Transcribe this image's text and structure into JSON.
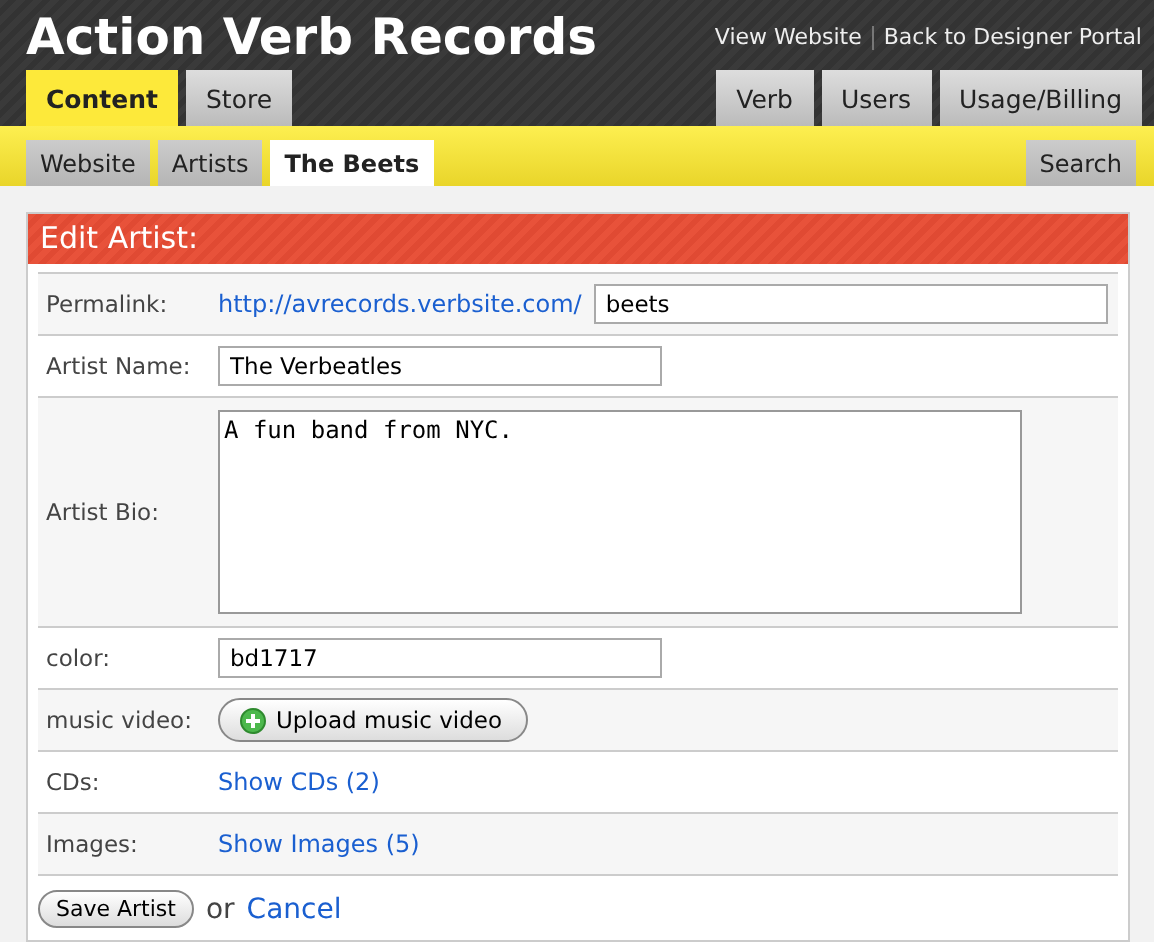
{
  "header": {
    "title": "Action Verb Records",
    "links": [
      "View Website",
      "Back to Designer Portal"
    ]
  },
  "main_tabs_left": [
    {
      "label": "Content",
      "selected": true
    },
    {
      "label": "Store",
      "selected": false
    }
  ],
  "main_tabs_right": [
    {
      "label": "Verb",
      "selected": false
    },
    {
      "label": "Users",
      "selected": false
    },
    {
      "label": "Usage/Billing",
      "selected": false
    }
  ],
  "sub_tabs_left": [
    {
      "label": "Website",
      "selected": false
    },
    {
      "label": "Artists",
      "selected": false
    },
    {
      "label": "The Beets",
      "selected": true
    }
  ],
  "sub_tabs_right": [
    {
      "label": "Search",
      "selected": false
    }
  ],
  "panel": {
    "title": "Edit Artist:",
    "rows": [
      {
        "kind": "permalink",
        "label": "Permalink:",
        "prefix": "http://avrecords.verbsite.com/",
        "value": "beets"
      },
      {
        "kind": "input",
        "label": "Artist Name:",
        "value": "The Verbeatles"
      },
      {
        "kind": "textarea",
        "label": "Artist Bio:",
        "value": "A fun band from NYC."
      },
      {
        "kind": "input",
        "label": "color:",
        "value": "bd1717"
      },
      {
        "kind": "upload",
        "label": "music video:",
        "button": "Upload music video"
      },
      {
        "kind": "link",
        "label": "CDs:",
        "link": "Show CDs (2)"
      },
      {
        "kind": "link",
        "label": "Images:",
        "link": "Show Images (5)"
      }
    ],
    "save": "Save Artist",
    "or": "or",
    "cancel": "Cancel"
  }
}
